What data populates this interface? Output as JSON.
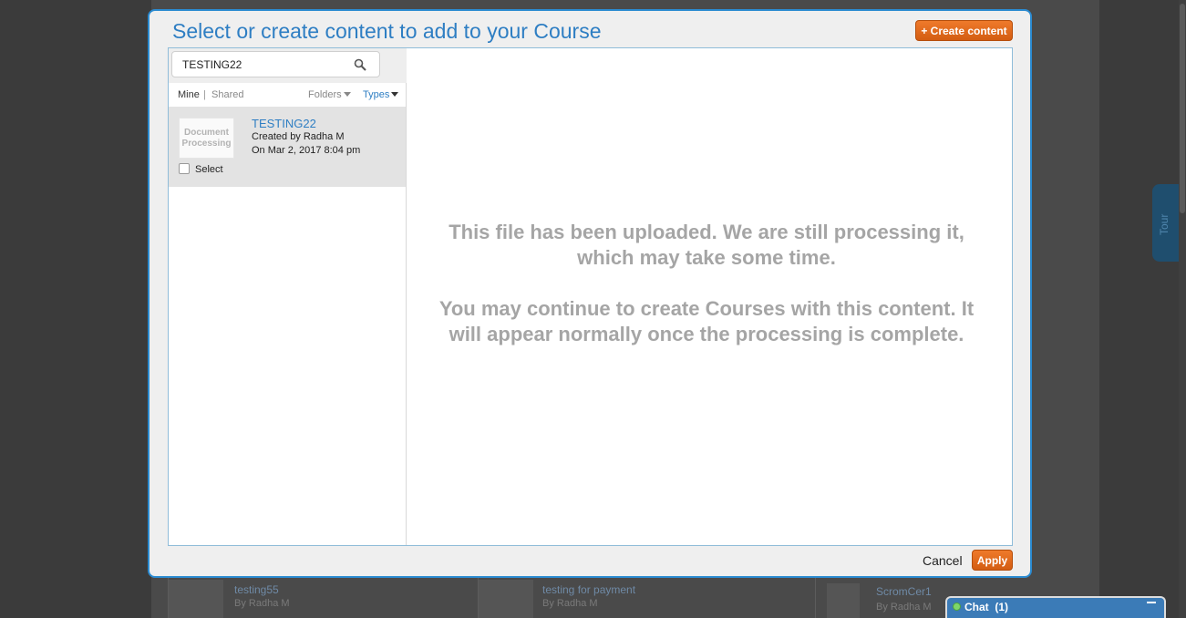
{
  "modal": {
    "title": "Select or create content to add to your Course",
    "create_button": "+ Create content",
    "cancel_label": "Cancel",
    "apply_label": "Apply"
  },
  "search": {
    "value": "TESTING22",
    "icon": "search-icon"
  },
  "filters": {
    "mine": "Mine",
    "separator": "|",
    "shared": "Shared",
    "folders": "Folders",
    "types": "Types"
  },
  "results": [
    {
      "thumbnail_text": "Document Processing",
      "title": "TESTING22",
      "created_by": "Created by Radha M",
      "created_on": "On Mar 2, 2017 8:04 pm",
      "select_label": "Select",
      "selected": false
    }
  ],
  "preview": {
    "message_line1": "This file has been uploaded. We are still processing it, which may take some time.",
    "message_line2": "You may continue to create Courses with this content. It will appear normally once the processing is complete."
  },
  "background": {
    "cards": [
      {
        "title": "testing55",
        "author": "By Radha M"
      },
      {
        "title": "testing for payment",
        "author": "By Radha M"
      },
      {
        "title": "ScromCer1",
        "author": "By Radha M"
      }
    ],
    "tour_label": "Tour"
  },
  "chat": {
    "label": "Chat",
    "count": "(1)"
  },
  "colors": {
    "accent_blue": "#2e7ec3",
    "modal_border": "#2b8bd1",
    "orange_button": "#e06a1b",
    "chat_bar": "#3b7bb7"
  }
}
